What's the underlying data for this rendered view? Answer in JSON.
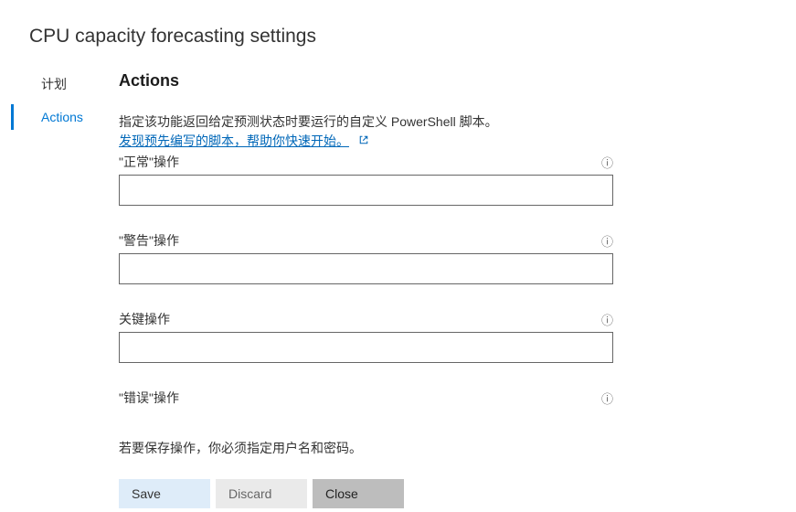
{
  "page_title": "CPU capacity forecasting settings",
  "sidebar": {
    "items": [
      {
        "label": "计划",
        "active": false
      },
      {
        "label": "Actions",
        "active": true
      }
    ]
  },
  "section_heading": "Actions",
  "description": "指定该功能返回给定预测状态时要运行的自定义 PowerShell 脚本。",
  "help_link": "发现预先编写的脚本，帮助你快速开始。",
  "fields": [
    {
      "label": "\"正常\"操作",
      "value": ""
    },
    {
      "label": "\"警告\"操作",
      "value": ""
    },
    {
      "label": "关键操作",
      "value": ""
    },
    {
      "label": "\"错误\"操作",
      "value": ""
    }
  ],
  "note": "若要保存操作，你必须指定用户名和密码。",
  "buttons": {
    "save": "Save",
    "discard": "Discard",
    "close": "Close"
  }
}
